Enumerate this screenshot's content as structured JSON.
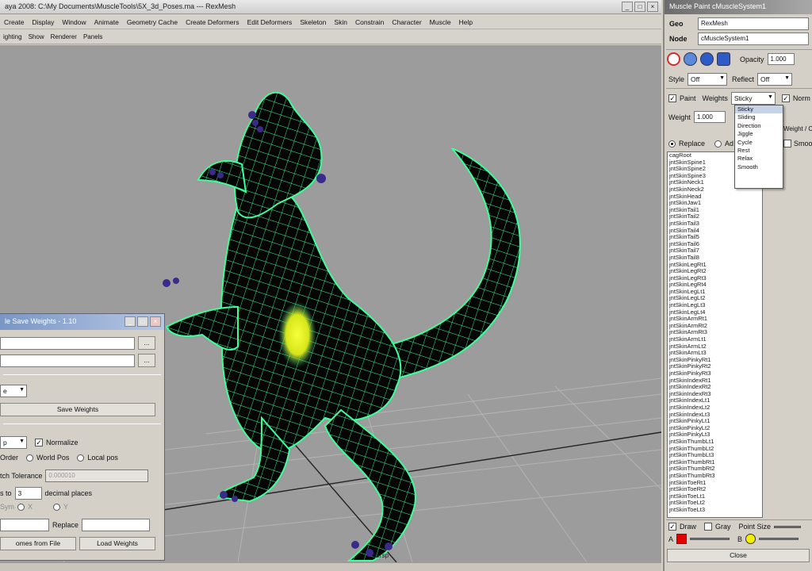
{
  "maya": {
    "title": "aya 2008: C:\\My Documents\\MuscleTools\\5X_3d_Poses.ma  ---  RexMesh",
    "menus": [
      "Create",
      "Display",
      "Window",
      "Animate",
      "Geometry Cache",
      "Create Deformers",
      "Edit Deformers",
      "Skeleton",
      "Skin",
      "Constrain",
      "Character",
      "Muscle",
      "Help"
    ],
    "panel_menus": [
      "ighting",
      "Show",
      "Renderer",
      "Panels"
    ],
    "viewport_label": "persp",
    "colors": {
      "viewport_bg": "#9c9c9c",
      "mesh_wire": "#3dff9a",
      "mesh_fill": "#050505",
      "weight_highlight": "#e7f020"
    }
  },
  "save_dialog": {
    "title": "le Save Weights - 1.10",
    "browse_label": "...",
    "mode_value": "e",
    "save_button": "Save Weights",
    "format_value": "p",
    "normalize_label": "Normalize",
    "normalize_checked": true,
    "order_label": "Order",
    "world_pos_label": "World Pos",
    "local_pos_label": "Local pos",
    "tolerance_label": "tch Tolerance",
    "tolerance_value": "0.000010",
    "precision_label": "s to",
    "precision_value": "3",
    "decimal_label": "decimal places",
    "rows_label": "Sym",
    "x_label": "X",
    "y_label": "Y",
    "replace_label": "Replace",
    "from_file_button": "omes from File",
    "load_button": "Load Weights"
  },
  "paint_panel": {
    "title": "Muscle Paint cMuscleSystem1",
    "geo_label": "Geo",
    "geo_value": "RexMesh",
    "node_label": "Node",
    "node_value": "cMuscleSystem1",
    "opacity_label": "Opacity",
    "opacity_value": "1.000",
    "style_label": "Style",
    "style_value": "Off",
    "reflect_label": "Reflect",
    "reflect_value": "Off",
    "paint_label": "Paint",
    "weights_label": "Weights",
    "weights_value": "Sticky",
    "norm_label": "Norm",
    "weight_label": "Weight",
    "weight_value": "1.000",
    "weight_tab": "Weight / C",
    "replace_label": "Replace",
    "add_label": "Ad",
    "smooth_label": "Smoo",
    "weight_options": [
      "Sticky",
      "Sliding",
      "Direction",
      "Jiggle",
      "Cycle",
      "Rest",
      "Relax",
      "Smooth"
    ],
    "joints": [
      "cagRoot",
      "jntSkinSpine1",
      "jntSkinSpine2",
      "jntSkinSpine3",
      "jntSkinNeck1",
      "jntSkinNeck2",
      "jntSkinHead",
      "jntSkinJaw1",
      "jntSkinTail1",
      "jntSkinTail2",
      "jntSkinTail3",
      "jntSkinTail4",
      "jntSkinTail5",
      "jntSkinTail6",
      "jntSkinTail7",
      "jntSkinTail8",
      "jntSkinLegRt1",
      "jntSkinLegRt2",
      "jntSkinLegRt3",
      "jntSkinLegRt4",
      "jntSkinLegLt1",
      "jntSkinLegLt2",
      "jntSkinLegLt3",
      "jntSkinLegLt4",
      "jntSkinArmRt1",
      "jntSkinArmRt2",
      "jntSkinArmRt3",
      "jntSkinArmLt1",
      "jntSkinArmLt2",
      "jntSkinArmLt3",
      "jntSkinPinkyRt1",
      "jntSkinPinkyRt2",
      "jntSkinPinkyRt3",
      "jntSkinIndexRt1",
      "jntSkinIndexRt2",
      "jntSkinIndexRt3",
      "jntSkinIndexLt1",
      "jntSkinIndexLt2",
      "jntSkinIndexLt3",
      "jntSkinPinkyLt1",
      "jntSkinPinkyLt2",
      "jntSkinPinkyLt3",
      "jntSkinThumbLt1",
      "jntSkinThumbLt2",
      "jntSkinThumbLt3",
      "jntSkinThumbRt1",
      "jntSkinThumbRt2",
      "jntSkinThumbRt3",
      "jntSkinToeRt1",
      "jntSkinToeRt2",
      "jntSkinToeLt1",
      "jntSkinToeLt2",
      "jntSkinToeLt3"
    ],
    "draw_label": "Draw",
    "gray_label": "Gray",
    "point_size_label": "Point Size",
    "a_label": "A",
    "b_label": "B",
    "close_button": "Close",
    "colors": {
      "a_color": "#e00000",
      "b_color": "#f4f000"
    }
  }
}
